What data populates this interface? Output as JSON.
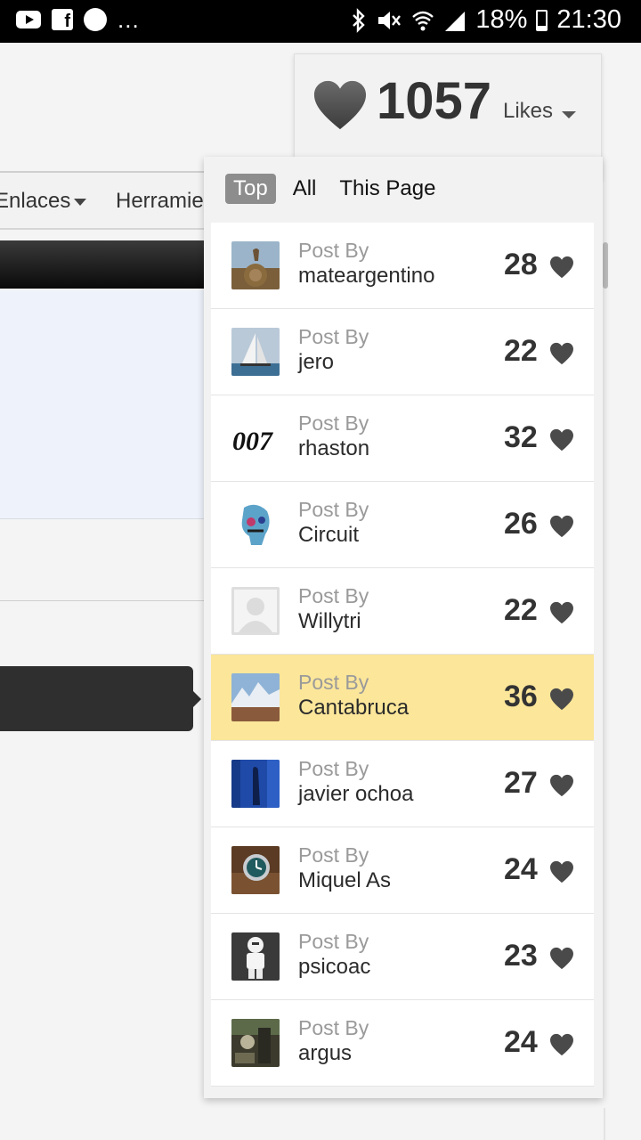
{
  "status_bar": {
    "app_icons": [
      "youtube-icon",
      "facebook-icon",
      "messenger-icon"
    ],
    "more": "...",
    "battery": "18%",
    "time": "21:30"
  },
  "background": {
    "nav": [
      {
        "label": "Enlaces"
      },
      {
        "label": "Herramie"
      }
    ]
  },
  "likes": {
    "count": "1057",
    "label": "Likes"
  },
  "tabs": [
    {
      "label": "Top",
      "active": true
    },
    {
      "label": "All",
      "active": false
    },
    {
      "label": "This Page",
      "active": false
    }
  ],
  "post_by_label": "Post By",
  "posts": [
    {
      "author": "mateargentino",
      "likes": "28",
      "highlighted": false
    },
    {
      "author": "jero",
      "likes": "22",
      "highlighted": false
    },
    {
      "author": "rhaston",
      "likes": "32",
      "highlighted": false
    },
    {
      "author": "Circuit",
      "likes": "26",
      "highlighted": false
    },
    {
      "author": "Willytri",
      "likes": "22",
      "highlighted": false
    },
    {
      "author": "Cantabruca",
      "likes": "36",
      "highlighted": true
    },
    {
      "author": "javier ochoa",
      "likes": "27",
      "highlighted": false
    },
    {
      "author": "Miquel As",
      "likes": "24",
      "highlighted": false
    },
    {
      "author": "psicoac",
      "likes": "23",
      "highlighted": false
    },
    {
      "author": "argus",
      "likes": "24",
      "highlighted": false
    }
  ],
  "colors": {
    "highlight": "#fbe69a",
    "active_tab": "#8d8d8d",
    "heart": "#4a4a4a"
  }
}
